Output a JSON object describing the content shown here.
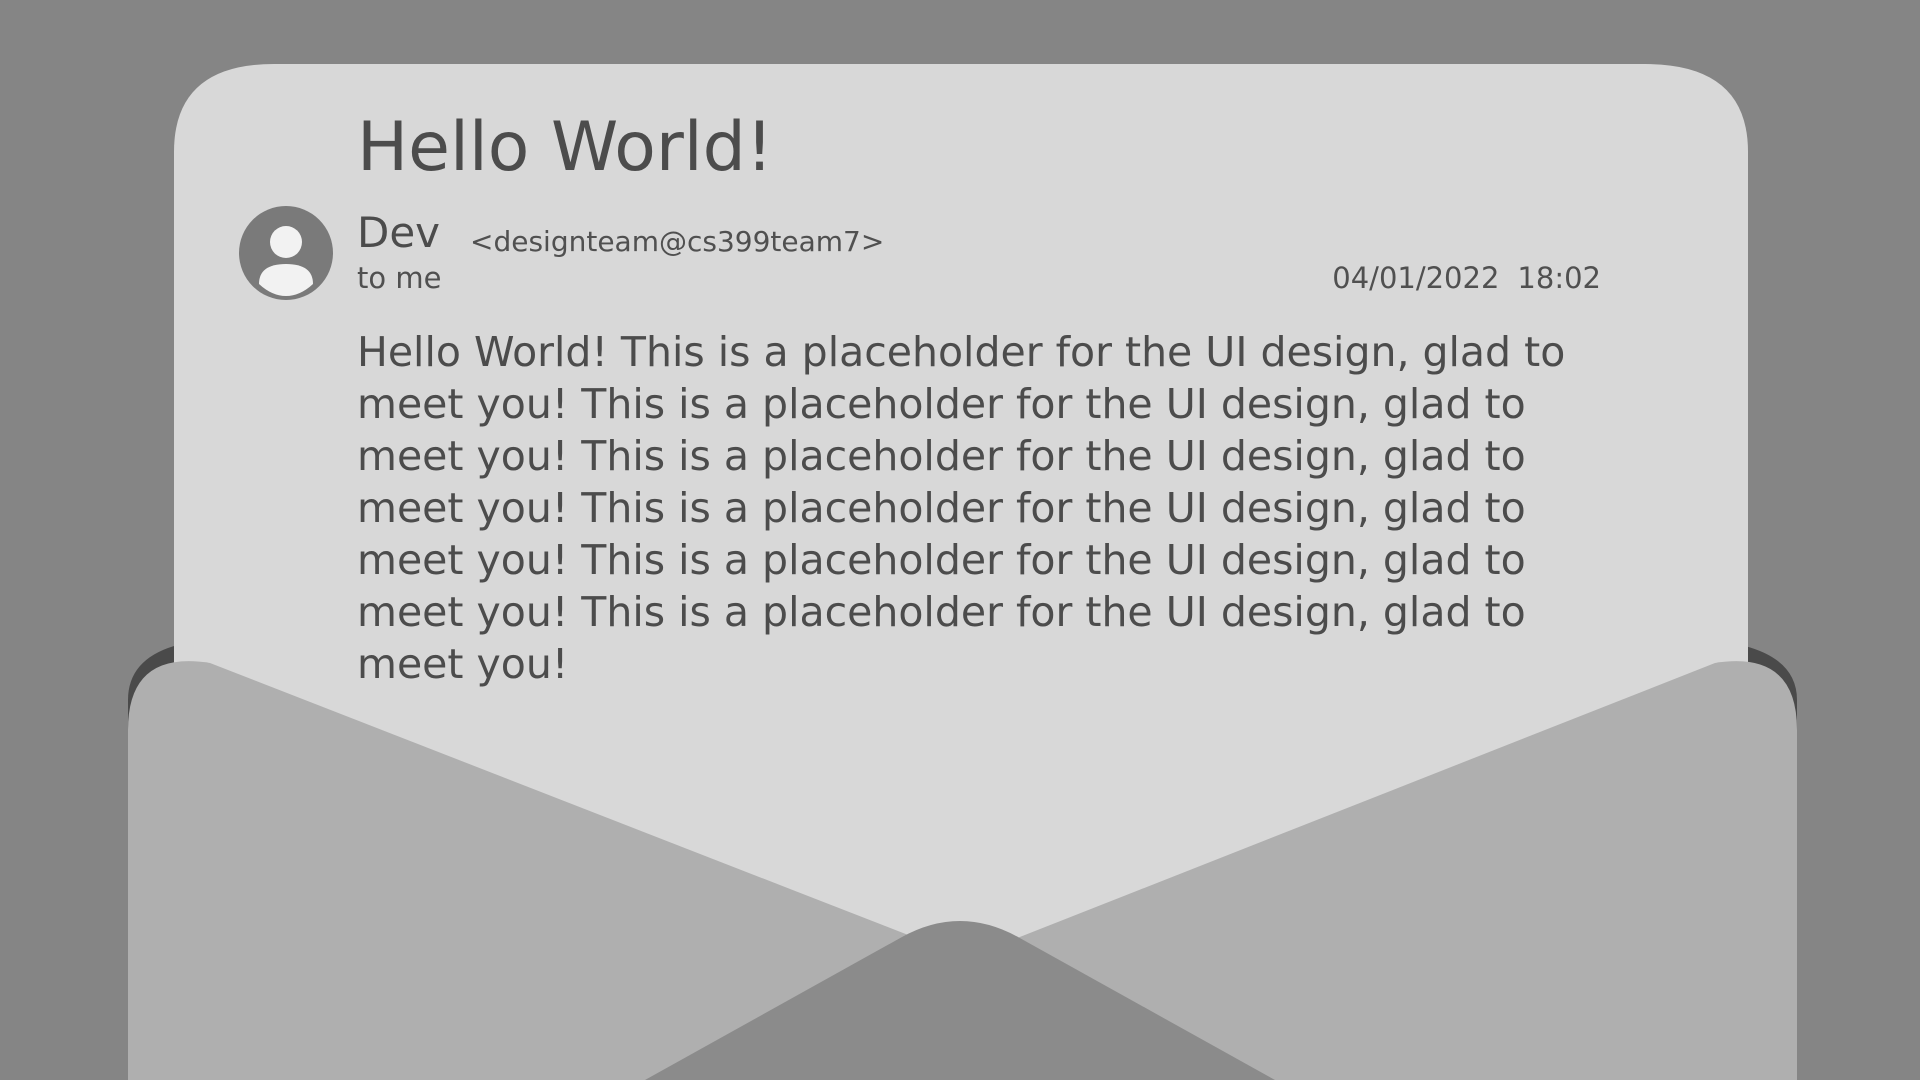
{
  "email": {
    "subject": "Hello World!",
    "sender": {
      "name": "Dev",
      "email": "<designteam@cs399team7>"
    },
    "recipient": "to me",
    "date": "04/01/2022",
    "time": "18:02",
    "body": "Hello World! This is a placeholder for the UI design, glad to meet you! This is a placeholder for the UI design, glad to meet you! This is a placeholder for the UI design, glad to meet you! This is a placeholder for the UI design, glad to meet you! This is a placeholder for the UI design, glad to meet you! This is a placeholder for the UI design, glad to meet you!"
  },
  "icons": {
    "avatar": "user-avatar-icon"
  },
  "colors": {
    "background": "#858585",
    "letter": "#d8d8d8",
    "envelope_flap": "#afafaf",
    "envelope_center": "#8b8b8b",
    "text": "#4c4c4c"
  }
}
